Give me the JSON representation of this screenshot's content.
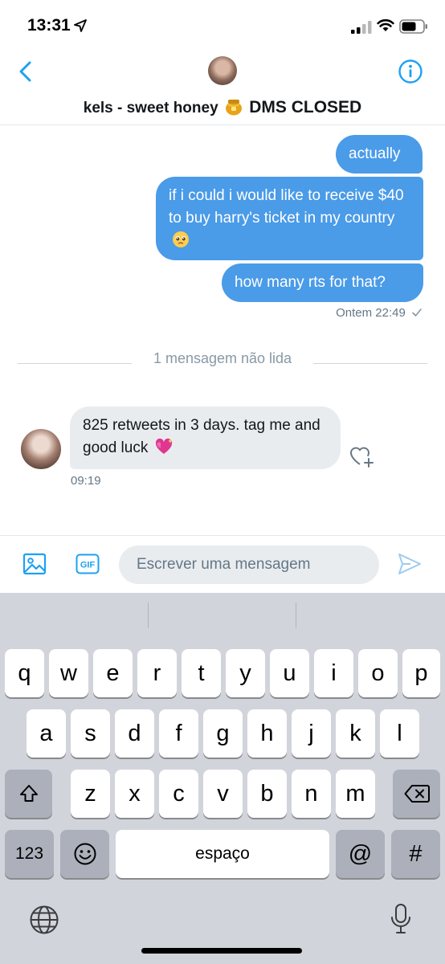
{
  "status_bar": {
    "time": "13:31"
  },
  "header": {
    "name": "kels - sweet honey",
    "status": "DMS CLOSED"
  },
  "messages": {
    "outgoing": [
      {
        "text": "actually"
      },
      {
        "text": "if i could i would like to receive $40 to buy harry's ticket in my country"
      },
      {
        "text": "how many rts for that?"
      }
    ],
    "outgoing_time": "Ontem 22:49",
    "unread_divider": "1 mensagem não lida",
    "incoming": [
      {
        "text": "825 retweets in 3 days. tag me and good luck"
      }
    ],
    "incoming_time": "09:19"
  },
  "composer": {
    "placeholder": "Escrever uma mensagem",
    "gif_label": "GIF"
  },
  "keyboard": {
    "row1": [
      "q",
      "w",
      "e",
      "r",
      "t",
      "y",
      "u",
      "i",
      "o",
      "p"
    ],
    "row2": [
      "a",
      "s",
      "d",
      "f",
      "g",
      "h",
      "j",
      "k",
      "l"
    ],
    "row3": [
      "z",
      "x",
      "c",
      "v",
      "b",
      "n",
      "m"
    ],
    "numbers_label": "123",
    "space_label": "espaço",
    "at_label": "@",
    "hash_label": "#"
  },
  "colors": {
    "accent": "#1da1f2",
    "outgoing_bubble": "#4a9be8",
    "incoming_bubble": "#e9ecef"
  },
  "icons": [
    "location-arrow-icon",
    "signal-icon",
    "wifi-icon",
    "battery-icon",
    "back-chevron-icon",
    "info-icon",
    "honey-pot-emoji",
    "pleading-face-emoji",
    "sparkling-hearts-emoji",
    "heart-plus-icon",
    "image-icon",
    "gif-icon",
    "send-icon",
    "shift-icon",
    "backspace-icon",
    "emoji-icon",
    "globe-icon",
    "microphone-icon"
  ]
}
